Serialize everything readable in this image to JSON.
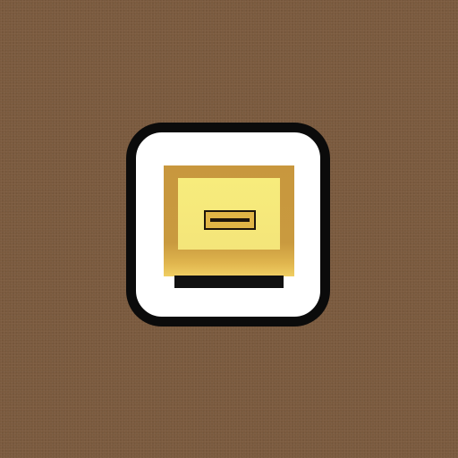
{
  "background_color": "#7a5a3e",
  "icon": {
    "name": "monitor-app-icon",
    "border_color": "#0b0b0b",
    "fill_color": "#ffffff",
    "monitor_color": "#c8973e",
    "screen_color": "#f7ec7c",
    "slot_color": "#e0b546",
    "base_color": "#111111"
  }
}
